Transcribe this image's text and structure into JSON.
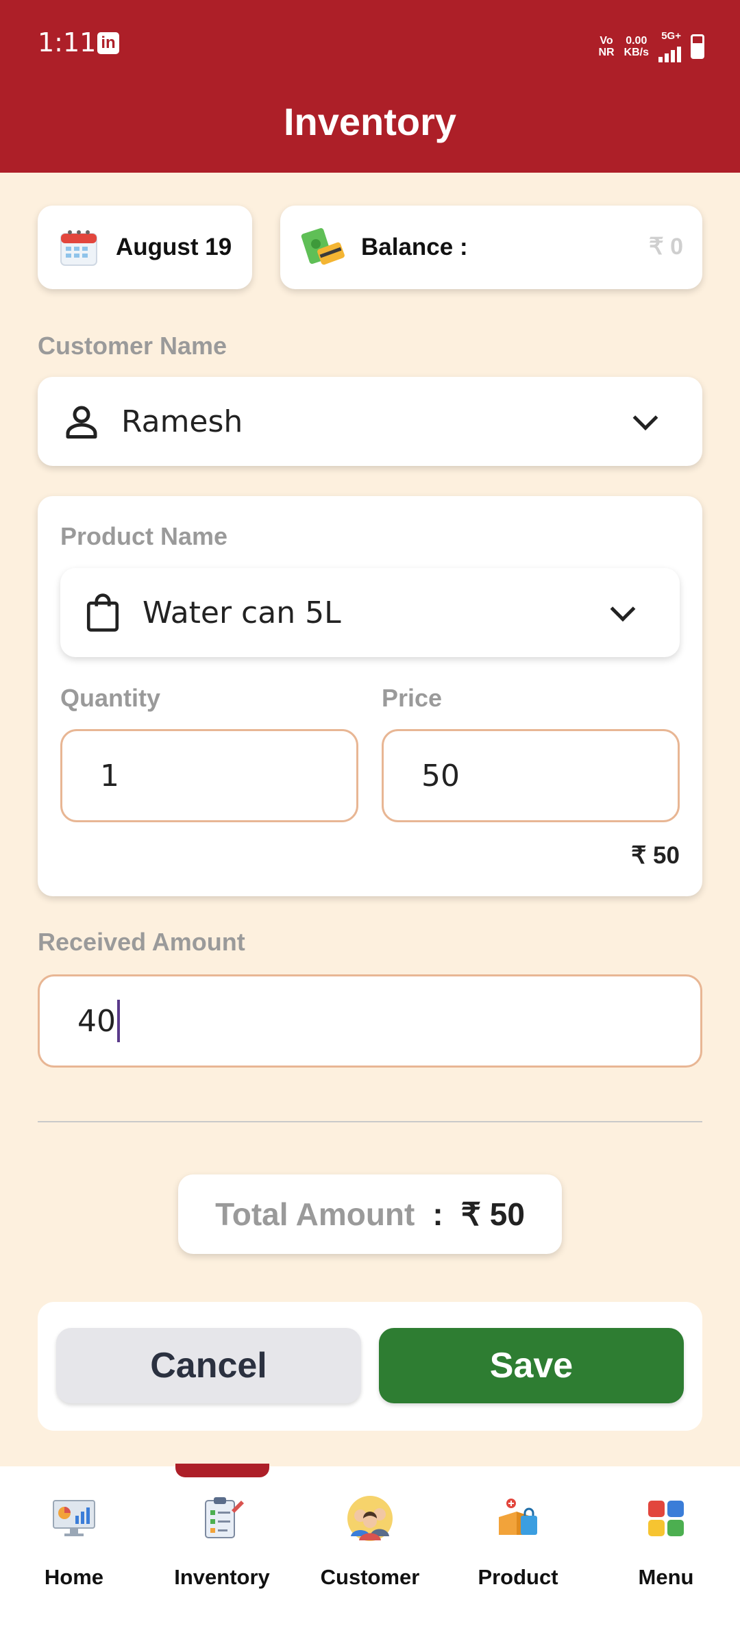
{
  "status_bar": {
    "time": "1:11",
    "network_line1": "Vo",
    "network_line2": "NR",
    "speed_line1": "0.00",
    "speed_line2": "KB/s",
    "signal": "5G+"
  },
  "header": {
    "title": "Inventory"
  },
  "summary": {
    "date": "August 19",
    "balance_label": "Balance :",
    "balance_value": "₹ 0"
  },
  "customer": {
    "label": "Customer Name",
    "value": "Ramesh"
  },
  "product": {
    "label": "Product Name",
    "value": "Water can 5L",
    "quantity_label": "Quantity",
    "quantity_value": "1",
    "price_label": "Price",
    "price_value": "50",
    "line_total": "₹ 50"
  },
  "received": {
    "label": "Received Amount",
    "value": "40"
  },
  "total": {
    "label": "Total Amount",
    "colon": ":",
    "value": "₹ 50"
  },
  "actions": {
    "cancel_label": "Cancel",
    "save_label": "Save"
  },
  "bottom_nav": {
    "items": [
      {
        "label": "Home",
        "icon": "dashboard-monitor-icon"
      },
      {
        "label": "Inventory",
        "icon": "clipboard-checklist-icon"
      },
      {
        "label": "Customer",
        "icon": "customers-group-icon"
      },
      {
        "label": "Product",
        "icon": "product-box-icon"
      },
      {
        "label": "Menu",
        "icon": "menu-grid-icon"
      }
    ],
    "active": "Inventory"
  },
  "colors": {
    "brand_red": "#ad1f28",
    "save_green": "#2e7d32",
    "background": "#fdf0de"
  }
}
